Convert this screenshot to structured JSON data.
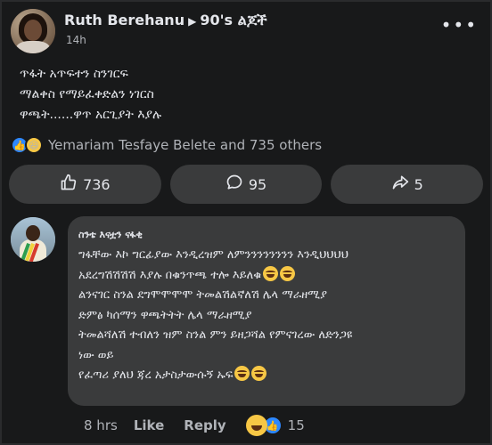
{
  "post": {
    "author": "Ruth Berehanu",
    "group": "90's ልጆች",
    "time": "14h",
    "lines": [
      "ጥፋት አጥፍተን ስንገርፍ",
      "ማልቀስ የማይፈቀድልን ነገርስ",
      "ዋጫት......ዋጥ አርጊያት እያሉ"
    ],
    "reactions_text": "Yemariam Tesfaye Belete and 735 others"
  },
  "actions": {
    "like_count": "736",
    "comment_count": "95",
    "share_count": "5"
  },
  "comment": {
    "author": "ስንቴ እናቷን ናፋቂ",
    "lines": [
      "ግፋቸው እኮ ግርፊያው እንዲረዝም ለምንንንንንንንን እንዲህህህህ",
      "አደረግሽሽሽሽ እያሉ በቁንጥጫ ተሎ እይለቁ",
      "ልንናገር ስንል ደግሞሞሞሞ ትመልሽልኛለሽ ሌላ ማራዘሚያ",
      "ድምፅ ካሰማን ዋጫትትት ሌላ ማራዘሚያ",
      "ትመልሻለሽ ተብለን ዝም ስንል ምን ይዘጋሻል የምናገረው ለድንጋዩ",
      "ነው ወይ",
      " የፈጣሪ ያለህ ጃረ አታስታውሱኝ ኡፍ"
    ],
    "time": "8 hrs",
    "like_label": "Like",
    "reply_label": "Reply",
    "reaction_count": "15"
  },
  "icons": {
    "more": "more-icon",
    "like": "thumbs-up-icon",
    "comment": "comment-icon",
    "share": "share-icon"
  }
}
